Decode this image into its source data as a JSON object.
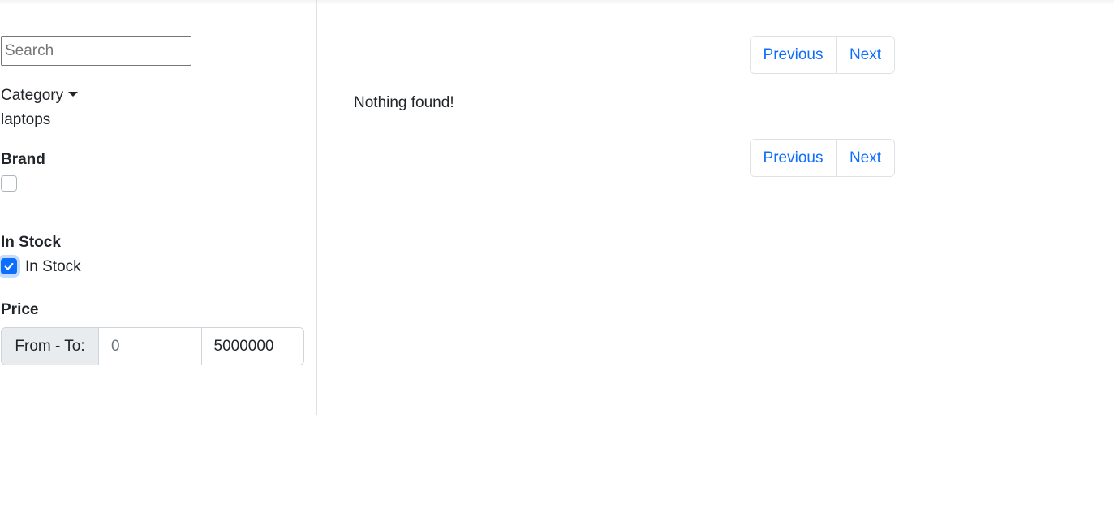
{
  "sidebar": {
    "search": {
      "placeholder": "Search",
      "value": ""
    },
    "category": {
      "label": "Category",
      "selected": "laptops"
    },
    "brand": {
      "label": "Brand"
    },
    "stock": {
      "label": "In Stock",
      "checkbox_label": "In Stock",
      "checked": true
    },
    "price": {
      "label": "Price",
      "addon": "From - To:",
      "from_placeholder": "0",
      "to_value": "5000000"
    }
  },
  "main": {
    "pagination_top": {
      "previous": "Previous",
      "next": "Next"
    },
    "empty_message": "Nothing found!",
    "pagination_bottom": {
      "previous": "Previous",
      "next": "Next"
    }
  },
  "colors": {
    "accent": "#0d6efd",
    "border": "#dee2e6",
    "addon_bg": "#e9ecef"
  }
}
